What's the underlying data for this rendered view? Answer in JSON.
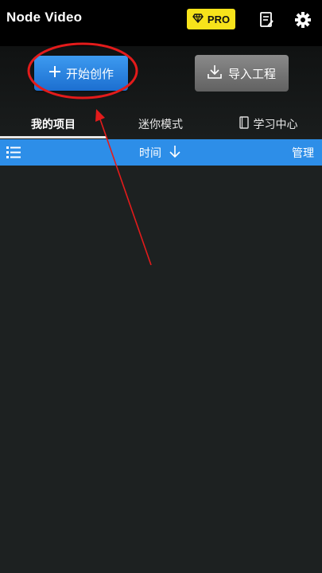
{
  "app": {
    "title": "Node Video",
    "pro_label": "PRO"
  },
  "actions": {
    "start_label": "开始创作",
    "import_label": "导入工程"
  },
  "tabs": [
    {
      "label": "我的项目",
      "active": true
    },
    {
      "label": "迷你模式",
      "active": false
    },
    {
      "label": "学习中心",
      "active": false
    }
  ],
  "toolbar": {
    "sort_label": "时间",
    "manage_label": "管理"
  },
  "colors": {
    "accent": "#2d8ee8",
    "pro": "#f7e31b",
    "annotation": "#e31b1b",
    "background": "#1d2121"
  },
  "icons": [
    "diamond-icon",
    "document-edit-icon",
    "gear-icon",
    "plus-icon",
    "download-icon",
    "book-icon",
    "list-icon",
    "arrow-down-icon"
  ]
}
